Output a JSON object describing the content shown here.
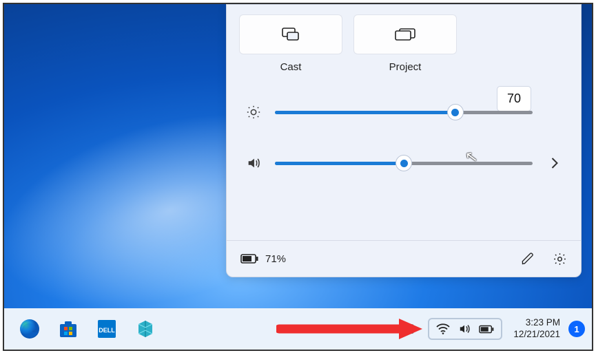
{
  "quick_settings": {
    "tiles": [
      {
        "id": "cast",
        "label": "Cast"
      },
      {
        "id": "project",
        "label": "Project"
      }
    ],
    "brightness": {
      "value": 70,
      "tooltip": "70"
    },
    "volume": {
      "value": 50
    },
    "footer": {
      "battery_text": "71%"
    }
  },
  "taskbar": {
    "clock": {
      "time": "3:23 PM",
      "date": "12/21/2021"
    },
    "notifications": "1"
  }
}
